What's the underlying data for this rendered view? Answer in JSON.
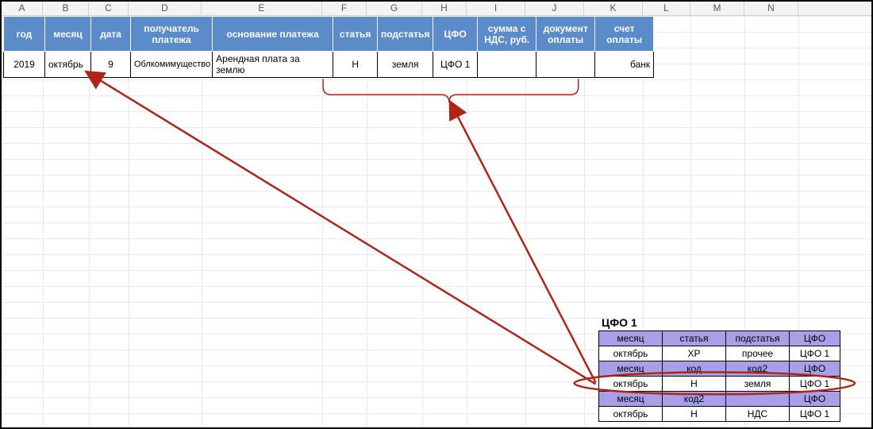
{
  "columns": [
    "A",
    "B",
    "C",
    "D",
    "E",
    "F",
    "G",
    "H",
    "I",
    "J",
    "K",
    "L",
    "M",
    "N"
  ],
  "top_headers": {
    "A": "год",
    "B": "месяц",
    "C": "дата",
    "D": "получатель платежа",
    "E": "основание платежа",
    "F": "статья",
    "G": "подстатья",
    "H": "ЦФО",
    "I": "сумма с НДС, руб.",
    "J": "документ оплаты",
    "K": "счет оплаты"
  },
  "top_row": {
    "A": "2019",
    "B": "октябрь",
    "C": "9",
    "D": "Облкомимущество",
    "E": "Арендная плата за землю",
    "F": "Н",
    "G": "земля",
    "H": "ЦФО 1",
    "I": "",
    "J": "",
    "K": "банк"
  },
  "sub_title": "ЦФО 1",
  "sub_headers": {
    "c1": "месяц",
    "c2": "статья",
    "c3": "подстатья",
    "c4": "ЦФО"
  },
  "sub_rows": [
    {
      "c1": "октябрь",
      "c2": "ХР",
      "c3": "прочее",
      "c4": "ЦФО 1"
    },
    {
      "c1": "месяц",
      "c2": "код",
      "c3": "код2",
      "c4": "ЦФО",
      "is_header": true
    },
    {
      "c1": "октябрь",
      "c2": "Н",
      "c3": "земля",
      "c4": "ЦФО 1"
    },
    {
      "c1": "месяц",
      "c2": "код2",
      "c3": "",
      "c4": "ЦФО",
      "is_header": true
    },
    {
      "c1": "октябрь",
      "c2": "Н",
      "c3": "НДС",
      "c4": "ЦФО 1"
    }
  ],
  "colors": {
    "header_blue": "#5b8bc9",
    "sub_purple": "#a7a0e8",
    "arrow": "#b02418"
  }
}
